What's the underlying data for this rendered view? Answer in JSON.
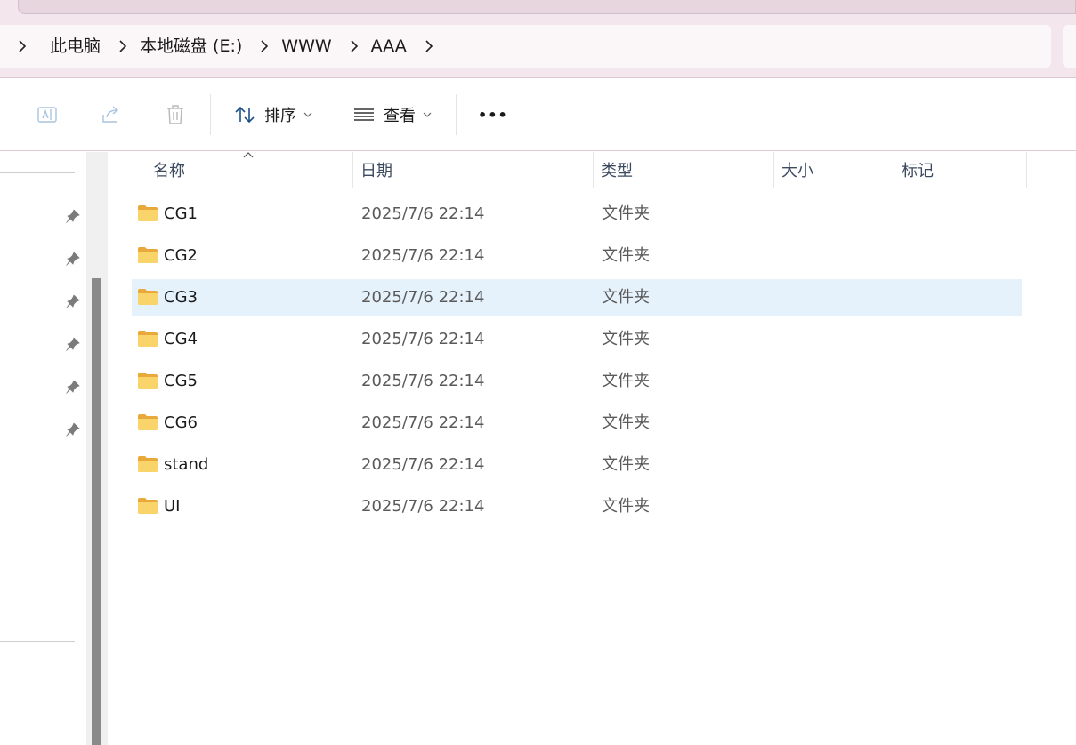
{
  "breadcrumb": [
    "此电脑",
    "本地磁盘 (E:)",
    "WWW",
    "AAA"
  ],
  "toolbar": {
    "sort_label": "排序",
    "view_label": "查看",
    "more_label": "•••"
  },
  "columns": {
    "name": "名称",
    "date": "日期",
    "type": "类型",
    "size": "大小",
    "tags": "标记"
  },
  "files": [
    {
      "name": "CG1",
      "date": "2025/7/6 22:14",
      "type": "文件夹"
    },
    {
      "name": "CG2",
      "date": "2025/7/6 22:14",
      "type": "文件夹"
    },
    {
      "name": "CG3",
      "date": "2025/7/6 22:14",
      "type": "文件夹"
    },
    {
      "name": "CG4",
      "date": "2025/7/6 22:14",
      "type": "文件夹"
    },
    {
      "name": "CG5",
      "date": "2025/7/6 22:14",
      "type": "文件夹"
    },
    {
      "name": "CG6",
      "date": "2025/7/6 22:14",
      "type": "文件夹"
    },
    {
      "name": "stand",
      "date": "2025/7/6 22:14",
      "type": "文件夹"
    },
    {
      "name": "UI",
      "date": "2025/7/6 22:14",
      "type": "文件夹"
    }
  ],
  "selected_index": 2,
  "icons": {
    "toolbar_left": [
      "rename-icon",
      "share-icon",
      "delete-icon"
    ],
    "sort": "sort-arrows-icon",
    "view": "view-list-icon",
    "pin": "pin-icon",
    "folder": "folder-icon"
  },
  "colors": {
    "selection": "#e5f1fb",
    "folder": "#f7c948",
    "accent": "#3a6fb0"
  }
}
